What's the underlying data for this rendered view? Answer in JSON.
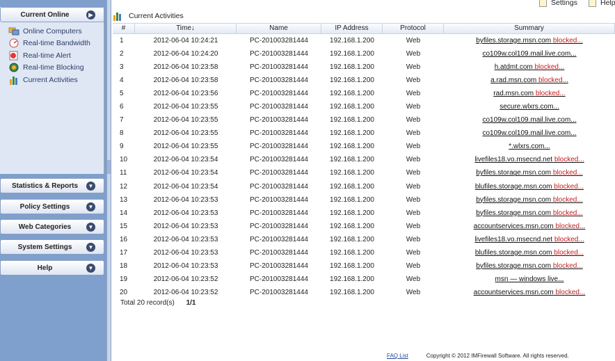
{
  "top": {
    "settings": "Settings",
    "help": "Help"
  },
  "sidebar": {
    "current_online": "Current Online",
    "items": [
      {
        "label": "Online Computers",
        "icon": "computers-icon"
      },
      {
        "label": "Real-time Bandwidth",
        "icon": "bandwidth-icon"
      },
      {
        "label": "Real-time Alert",
        "icon": "alert-icon"
      },
      {
        "label": "Real-time Blocking",
        "icon": "blocking-icon"
      },
      {
        "label": "Current Activities",
        "icon": "activities-icon"
      }
    ],
    "sections": [
      "Statistics & Reports",
      "Policy Settings",
      "Web Categories",
      "System Settings",
      "Help"
    ]
  },
  "header": {
    "title": "Current Activities"
  },
  "table": {
    "columns": [
      "#",
      "Time↓",
      "Name",
      "IP Address",
      "Protocol",
      "Summary"
    ],
    "rows": [
      {
        "n": "1",
        "time": "2012-06-04 10:24:21",
        "name": "PC-201003281444",
        "ip": "192.168.1.200",
        "proto": "Web",
        "sum": "byfiles.storage.msn.com",
        "blocked": "blocked..."
      },
      {
        "n": "2",
        "time": "2012-06-04 10:24:20",
        "name": "PC-201003281444",
        "ip": "192.168.1.200",
        "proto": "Web",
        "sum": "co109w.col109.mail.live.com...",
        "blocked": ""
      },
      {
        "n": "3",
        "time": "2012-06-04 10:23:58",
        "name": "PC-201003281444",
        "ip": "192.168.1.200",
        "proto": "Web",
        "sum": "h.atdmt.com",
        "blocked": "blocked..."
      },
      {
        "n": "4",
        "time": "2012-06-04 10:23:58",
        "name": "PC-201003281444",
        "ip": "192.168.1.200",
        "proto": "Web",
        "sum": "a.rad.msn.com",
        "blocked": "blocked..."
      },
      {
        "n": "5",
        "time": "2012-06-04 10:23:56",
        "name": "PC-201003281444",
        "ip": "192.168.1.200",
        "proto": "Web",
        "sum": "rad.msn.com",
        "blocked": "blocked..."
      },
      {
        "n": "6",
        "time": "2012-06-04 10:23:55",
        "name": "PC-201003281444",
        "ip": "192.168.1.200",
        "proto": "Web",
        "sum": "secure.wlxrs.com...",
        "blocked": ""
      },
      {
        "n": "7",
        "time": "2012-06-04 10:23:55",
        "name": "PC-201003281444",
        "ip": "192.168.1.200",
        "proto": "Web",
        "sum": "co109w.col109.mail.live.com...",
        "blocked": ""
      },
      {
        "n": "8",
        "time": "2012-06-04 10:23:55",
        "name": "PC-201003281444",
        "ip": "192.168.1.200",
        "proto": "Web",
        "sum": "co109w.col109.mail.live.com...",
        "blocked": ""
      },
      {
        "n": "9",
        "time": "2012-06-04 10:23:55",
        "name": "PC-201003281444",
        "ip": "192.168.1.200",
        "proto": "Web",
        "sum": "*.wlxrs.com...",
        "blocked": ""
      },
      {
        "n": "10",
        "time": "2012-06-04 10:23:54",
        "name": "PC-201003281444",
        "ip": "192.168.1.200",
        "proto": "Web",
        "sum": "livefiles18.vo.msecnd.net",
        "blocked": "blocked..."
      },
      {
        "n": "11",
        "time": "2012-06-04 10:23:54",
        "name": "PC-201003281444",
        "ip": "192.168.1.200",
        "proto": "Web",
        "sum": "byfiles.storage.msn.com",
        "blocked": "blocked..."
      },
      {
        "n": "12",
        "time": "2012-06-04 10:23:54",
        "name": "PC-201003281444",
        "ip": "192.168.1.200",
        "proto": "Web",
        "sum": "blufiles.storage.msn.com",
        "blocked": "blocked..."
      },
      {
        "n": "13",
        "time": "2012-06-04 10:23:53",
        "name": "PC-201003281444",
        "ip": "192.168.1.200",
        "proto": "Web",
        "sum": "byfiles.storage.msn.com",
        "blocked": "blocked..."
      },
      {
        "n": "14",
        "time": "2012-06-04 10:23:53",
        "name": "PC-201003281444",
        "ip": "192.168.1.200",
        "proto": "Web",
        "sum": "byfiles.storage.msn.com",
        "blocked": "blocked..."
      },
      {
        "n": "15",
        "time": "2012-06-04 10:23:53",
        "name": "PC-201003281444",
        "ip": "192.168.1.200",
        "proto": "Web",
        "sum": "accountservices.msn.com",
        "blocked": "blocked..."
      },
      {
        "n": "16",
        "time": "2012-06-04 10:23:53",
        "name": "PC-201003281444",
        "ip": "192.168.1.200",
        "proto": "Web",
        "sum": "livefiles18.vo.msecnd.net",
        "blocked": "blocked..."
      },
      {
        "n": "17",
        "time": "2012-06-04 10:23:53",
        "name": "PC-201003281444",
        "ip": "192.168.1.200",
        "proto": "Web",
        "sum": "blufiles.storage.msn.com",
        "blocked": "blocked..."
      },
      {
        "n": "18",
        "time": "2012-06-04 10:23:53",
        "name": "PC-201003281444",
        "ip": "192.168.1.200",
        "proto": "Web",
        "sum": "byfiles.storage.msn.com",
        "blocked": "blocked..."
      },
      {
        "n": "19",
        "time": "2012-06-04 10:23:52",
        "name": "PC-201003281444",
        "ip": "192.168.1.200",
        "proto": "Web",
        "sum": "msn — windows live...",
        "blocked": ""
      },
      {
        "n": "20",
        "time": "2012-06-04 10:23:52",
        "name": "PC-201003281444",
        "ip": "192.168.1.200",
        "proto": "Web",
        "sum": "accountservices.msn.com",
        "blocked": "blocked..."
      }
    ]
  },
  "footer": {
    "total": "Total 20 record(s)",
    "pages": "1/1",
    "faq": "FAQ List",
    "copyright": "Copyright © 2012   IMFirewall Software. All rights reserved."
  },
  "colors": {
    "blocked": "#c02020",
    "sidebar": "#7f9fcc",
    "panel": "#dfe7f5"
  }
}
